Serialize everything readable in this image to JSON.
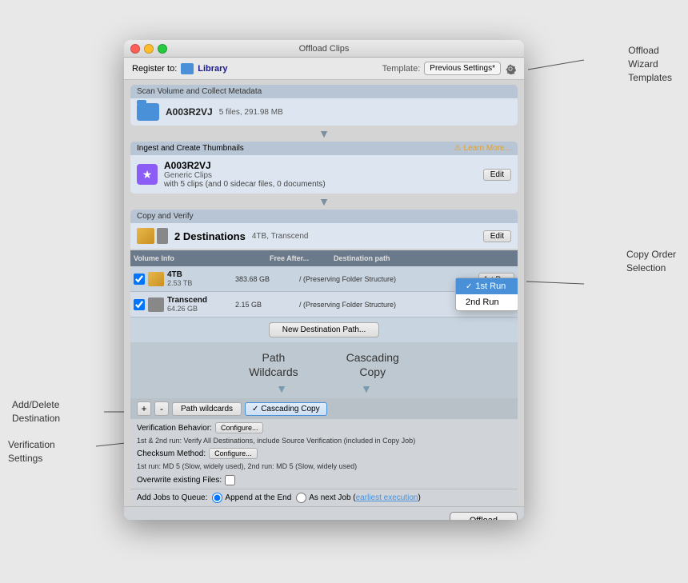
{
  "window": {
    "title": "Offload Clips",
    "register_label": "Register to:",
    "library_label": "Library",
    "template_label": "Template:",
    "template_value": "Previous Settings*"
  },
  "scan_section": {
    "header": "Scan Volume and Collect Metadata",
    "volume_name": "A003R2VJ",
    "volume_info": "5 files, 291.98 MB"
  },
  "ingest_section": {
    "header": "Ingest and Create Thumbnails",
    "learn_more": "Learn More...",
    "volume_name": "A003R2VJ",
    "clip_type": "Generic Clips",
    "clips_desc": "with 5 clips (and 0 sidecar files, 0 documents)",
    "edit_label": "Edit"
  },
  "copy_section": {
    "header": "Copy and Verify",
    "destinations_label": "2 Destinations",
    "destinations_info": "4TB, Transcend",
    "edit_label": "Edit"
  },
  "table": {
    "headers": [
      "Volume Info",
      "",
      "Free After...",
      "Destination path"
    ],
    "rows": [
      {
        "checked": true,
        "name": "4TB",
        "size": "2.53 TB",
        "free": "383.68 GB",
        "path": "/ (Preserving Folder Structure)",
        "run": "1st Run",
        "type": "hdd"
      },
      {
        "checked": true,
        "name": "Transcend",
        "size": "64.26 GB",
        "free": "2.15 GB",
        "path": "/ (Preserving Folder Structure)",
        "run": "2nd Run",
        "type": "tablet"
      }
    ],
    "dropdown": {
      "items": [
        "1st Run",
        "2nd Run"
      ],
      "selected": "1st Run"
    }
  },
  "new_dest_btn": "New Destination Path...",
  "path_wildcards": {
    "label1": "Path\nWildcards",
    "label2": "Cascading\nCopy"
  },
  "controls": {
    "plus": "+",
    "minus": "-",
    "path_wildcards_btn": "Path wildcards",
    "cascading_btn": "✓ Cascading Copy"
  },
  "verification": {
    "behavior_label": "Verification Behavior:",
    "configure1": "Configure...",
    "desc1": "1st & 2nd run:\nVerify All Destinations, include Source Verification (included in Copy Job)",
    "checksum_label": "Checksum Method:",
    "configure2": "Configure...",
    "desc2": "1st run: MD 5 (Slow, widely used), 2nd run: MD 5 (Slow, widely used)",
    "overwrite_label": "Overwrite existing Files:"
  },
  "queue": {
    "label": "Add Jobs to Queue:",
    "option1": "Append at the End",
    "option2": "As next Job (earliest execution)"
  },
  "footer": {
    "offload_btn": "Offload"
  },
  "annotations": {
    "offload_wizard": "Offload\nWizard\nTemplates",
    "copy_order": "Copy Order\nSelection",
    "add_delete": "Add/Delete\nDestination",
    "verification": "Verification\nSettings"
  }
}
